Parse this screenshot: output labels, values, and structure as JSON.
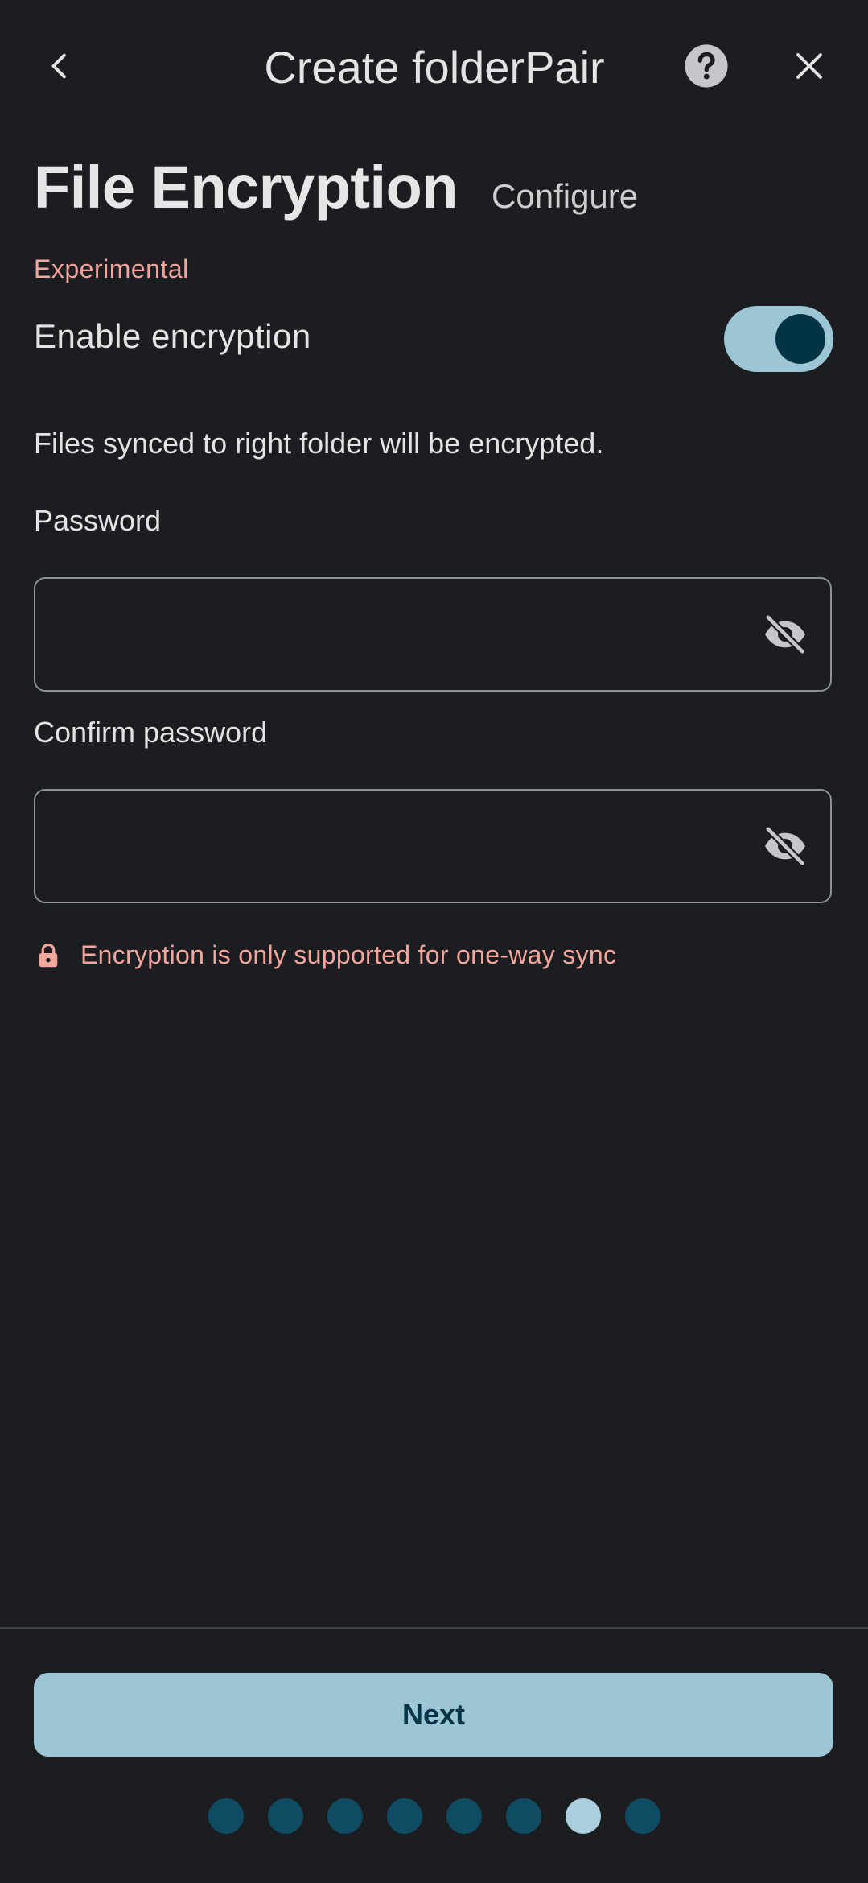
{
  "topbar": {
    "title": "Create folderPair",
    "back_icon": "chevron-left-icon",
    "help_icon": "help-circle-icon",
    "close_icon": "close-icon"
  },
  "section": {
    "title": "File Encryption",
    "subtitle": "Configure"
  },
  "experimental_label": "Experimental",
  "encryption_toggle": {
    "label": "Enable encryption",
    "enabled": true
  },
  "info_text": "Files synced to right folder will be encrypted.",
  "password": {
    "label": "Password",
    "value": "",
    "visibility_icon": "eye-off-icon"
  },
  "confirm_password": {
    "label": "Confirm password",
    "value": "",
    "visibility_icon": "eye-off-icon"
  },
  "warning": {
    "icon": "lock-icon",
    "text": "Encryption is only supported for one-way sync"
  },
  "footer": {
    "next_label": "Next",
    "total_steps": 8,
    "current_step": 7
  },
  "colors": {
    "background": "#1b1d20",
    "accent": "#9cc6d6",
    "accent_dark": "#003544",
    "warning": "#f4a59c",
    "dot_inactive": "#0f4c64"
  }
}
